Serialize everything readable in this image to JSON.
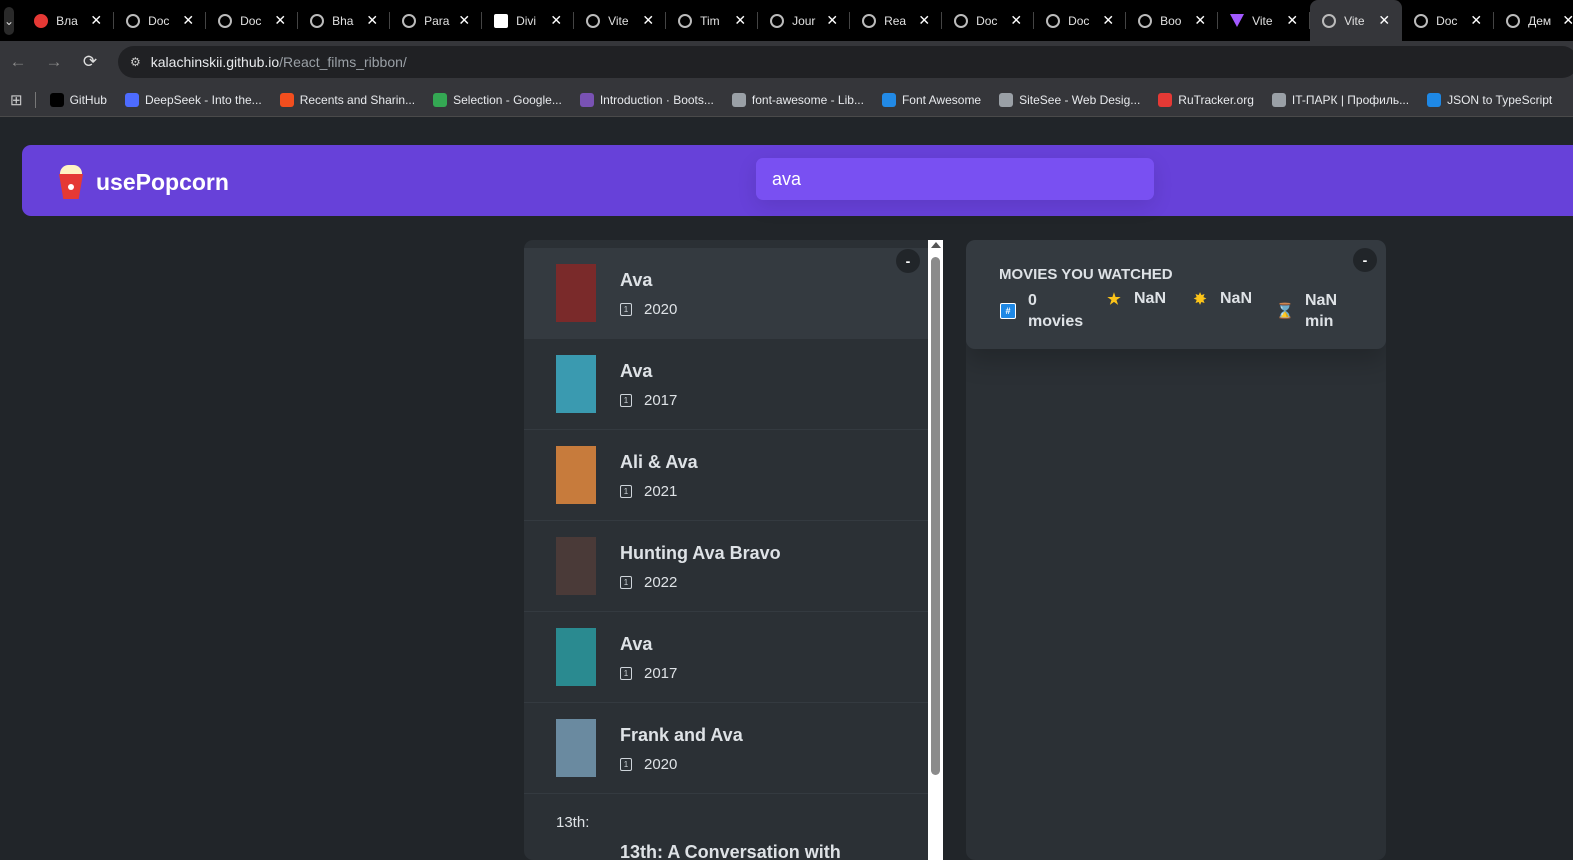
{
  "browser": {
    "tabs": [
      {
        "title": "Вла",
        "icon": "red-record-icon"
      },
      {
        "title": "Doc",
        "icon": "globe-icon"
      },
      {
        "title": "Doc",
        "icon": "globe-icon"
      },
      {
        "title": "Bha",
        "icon": "globe-icon"
      },
      {
        "title": "Para",
        "icon": "globe-icon"
      },
      {
        "title": "Divi",
        "icon": "news-icon"
      },
      {
        "title": "Vite",
        "icon": "globe-icon"
      },
      {
        "title": "Tim",
        "icon": "globe-icon"
      },
      {
        "title": "Jour",
        "icon": "globe-icon"
      },
      {
        "title": "Rea",
        "icon": "globe-icon"
      },
      {
        "title": "Doc",
        "icon": "globe-icon"
      },
      {
        "title": "Doc",
        "icon": "globe-icon"
      },
      {
        "title": "Boo",
        "icon": "globe-icon"
      },
      {
        "title": "Vite",
        "icon": "vite-icon"
      },
      {
        "title": "Vite",
        "icon": "globe-icon",
        "active": true
      },
      {
        "title": "Doc",
        "icon": "globe-icon"
      },
      {
        "title": "Дем",
        "icon": "globe-icon"
      }
    ],
    "url_host": "kalachinskii.github.io",
    "url_path": "/React_films_ribbon/",
    "bookmarks": [
      {
        "label": "GitHub",
        "color": "#000000"
      },
      {
        "label": "DeepSeek - Into the...",
        "color": "#4d6bfe"
      },
      {
        "label": "Recents and Sharin...",
        "color": "#f24e1e"
      },
      {
        "label": "Selection - Google...",
        "color": "#34a853"
      },
      {
        "label": "Introduction · Boots...",
        "color": "#7952b3"
      },
      {
        "label": "font-awesome - Lib...",
        "color": "#9aa0a6"
      },
      {
        "label": "Font Awesome",
        "color": "#228ae6"
      },
      {
        "label": "SiteSee - Web Desig...",
        "color": "#9aa0a6"
      },
      {
        "label": "RuTracker.org",
        "color": "#e53935"
      },
      {
        "label": "IT-ПАРК | Профиль...",
        "color": "#9aa0a6"
      },
      {
        "label": "JSON to TypeScript",
        "color": "#1e88e5"
      }
    ]
  },
  "app": {
    "logo": "usePopcorn",
    "search_value": "ava",
    "toggle_label": "-",
    "movies": [
      {
        "title": "Ava",
        "year": "2020",
        "poster_color": "#7a2a2a"
      },
      {
        "title": "Ava",
        "year": "2017",
        "poster_color": "#3a9ab0"
      },
      {
        "title": "Ali & Ava",
        "year": "2021",
        "poster_color": "#c77b3c"
      },
      {
        "title": "Hunting Ava Bravo",
        "year": "2022",
        "poster_color": "#4a3a38"
      },
      {
        "title": "Ava",
        "year": "2017",
        "poster_color": "#2a8a90"
      },
      {
        "title": "Frank and Ava",
        "year": "2020",
        "poster_color": "#6a8aa0"
      },
      {
        "title": "13th: A Conversation with",
        "year": "",
        "poster_alt": "13th:"
      }
    ],
    "summary": {
      "heading": "Movies you watched",
      "movies_count": "0",
      "movies_label": "movies",
      "imdb_rating": "NaN",
      "user_rating": "NaN",
      "runtime": "NaN",
      "runtime_unit": "min"
    },
    "colors": {
      "primary": "#6741d9",
      "search": "#7950f2",
      "background": "#212529",
      "box": "#2b3035"
    }
  }
}
